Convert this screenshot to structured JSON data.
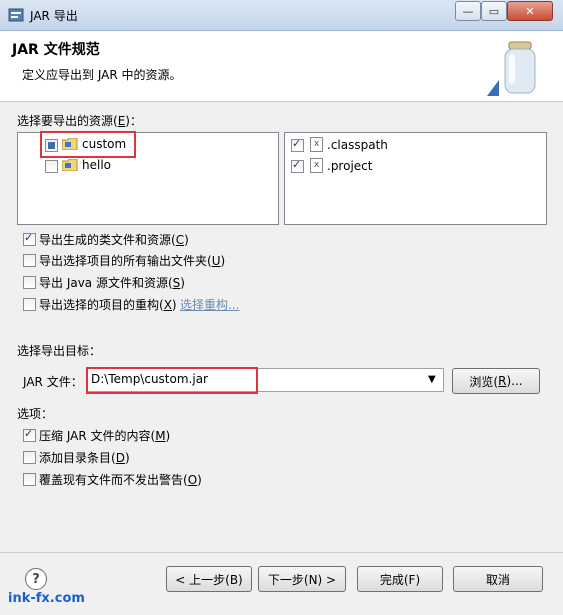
{
  "window": {
    "title": "JAR 导出",
    "min": "—",
    "max": "▭",
    "close": "✕"
  },
  "banner": {
    "title": "JAR 文件规范",
    "description": "定义应导出到 JAR 中的资源。"
  },
  "resources": {
    "label_prefix": "选择要导出的资源(",
    "label_key": "E",
    "label_suffix": ")：",
    "left": [
      {
        "name": "custom",
        "state": "partial"
      },
      {
        "name": "hello",
        "state": "unchecked"
      }
    ],
    "right": [
      {
        "name": ".classpath",
        "checked": true
      },
      {
        "name": ".project",
        "checked": true
      }
    ]
  },
  "export_options": [
    {
      "pre": "导出生成的类文件和资源(",
      "key": "C",
      "post": ")",
      "checked": true
    },
    {
      "pre": "导出选择项目的所有输出文件夹(",
      "key": "U",
      "post": ")",
      "checked": false
    },
    {
      "pre": "导出 Java 源文件和资源(",
      "key": "S",
      "post": ")",
      "checked": false
    },
    {
      "pre": "导出选择的项目的重构(",
      "key": "X",
      "post": ")",
      "checked": false,
      "link": "选择重构..."
    }
  ],
  "target": {
    "label": "选择导出目标：",
    "jar_label": "JAR 文件：",
    "jar_value": "D:\\Temp\\custom.jar",
    "browse_pre": "浏览(",
    "browse_key": "R",
    "browse_post": ")..."
  },
  "options": {
    "label": "选项：",
    "items": [
      {
        "pre": "压缩 JAR 文件的内容(",
        "key": "M",
        "post": ")",
        "checked": true
      },
      {
        "pre": "添加目录条目(",
        "key": "D",
        "post": ")",
        "checked": false
      },
      {
        "pre": "覆盖现有文件而不发出警告(",
        "key": "O",
        "post": ")",
        "checked": false
      }
    ]
  },
  "buttons": {
    "back": "< 上一步(B)",
    "next": "下一步(N) >",
    "finish": "完成(F)",
    "cancel": "取消"
  },
  "help": "?",
  "watermark": "ink-fx.com",
  "colors": {
    "highlight_box": "#e0343c",
    "link": "#6a8bb0"
  }
}
